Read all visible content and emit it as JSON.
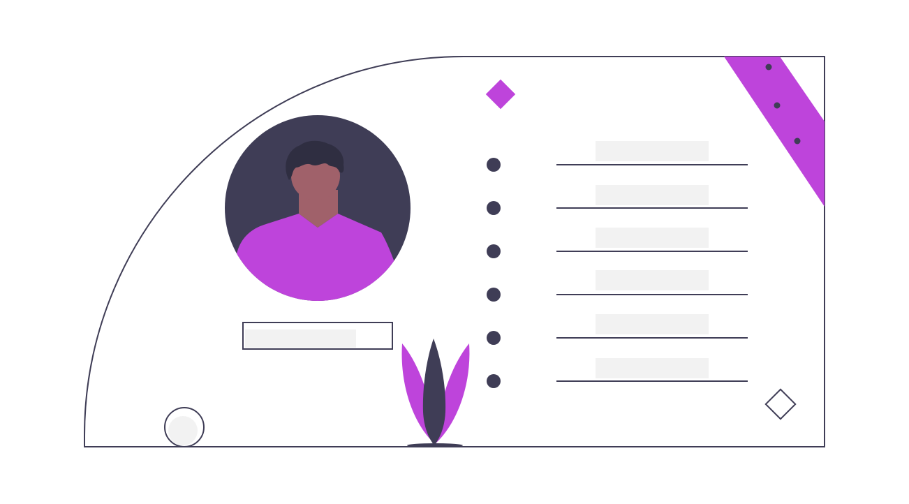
{
  "colors": {
    "background": "#ffffff",
    "outline": "#3f3d56",
    "accent": "#be44db",
    "skin": "#a0616a",
    "hair": "#2f2e41",
    "placeholder": "#f2f2f2"
  },
  "icons": {
    "avatar": "person-avatar-icon",
    "plant": "leaf-plant-icon",
    "diamond_filled": "diamond-filled-icon",
    "diamond_outline": "diamond-outline-icon",
    "bubble": "bubble-circle-icon",
    "ribbon": "corner-ribbon-icon",
    "bullet": "bullet-dot-icon"
  },
  "list": {
    "rows": [
      {
        "label": ""
      },
      {
        "label": ""
      },
      {
        "label": ""
      },
      {
        "label": ""
      },
      {
        "label": ""
      },
      {
        "label": ""
      }
    ]
  },
  "profile": {
    "name_field": ""
  }
}
